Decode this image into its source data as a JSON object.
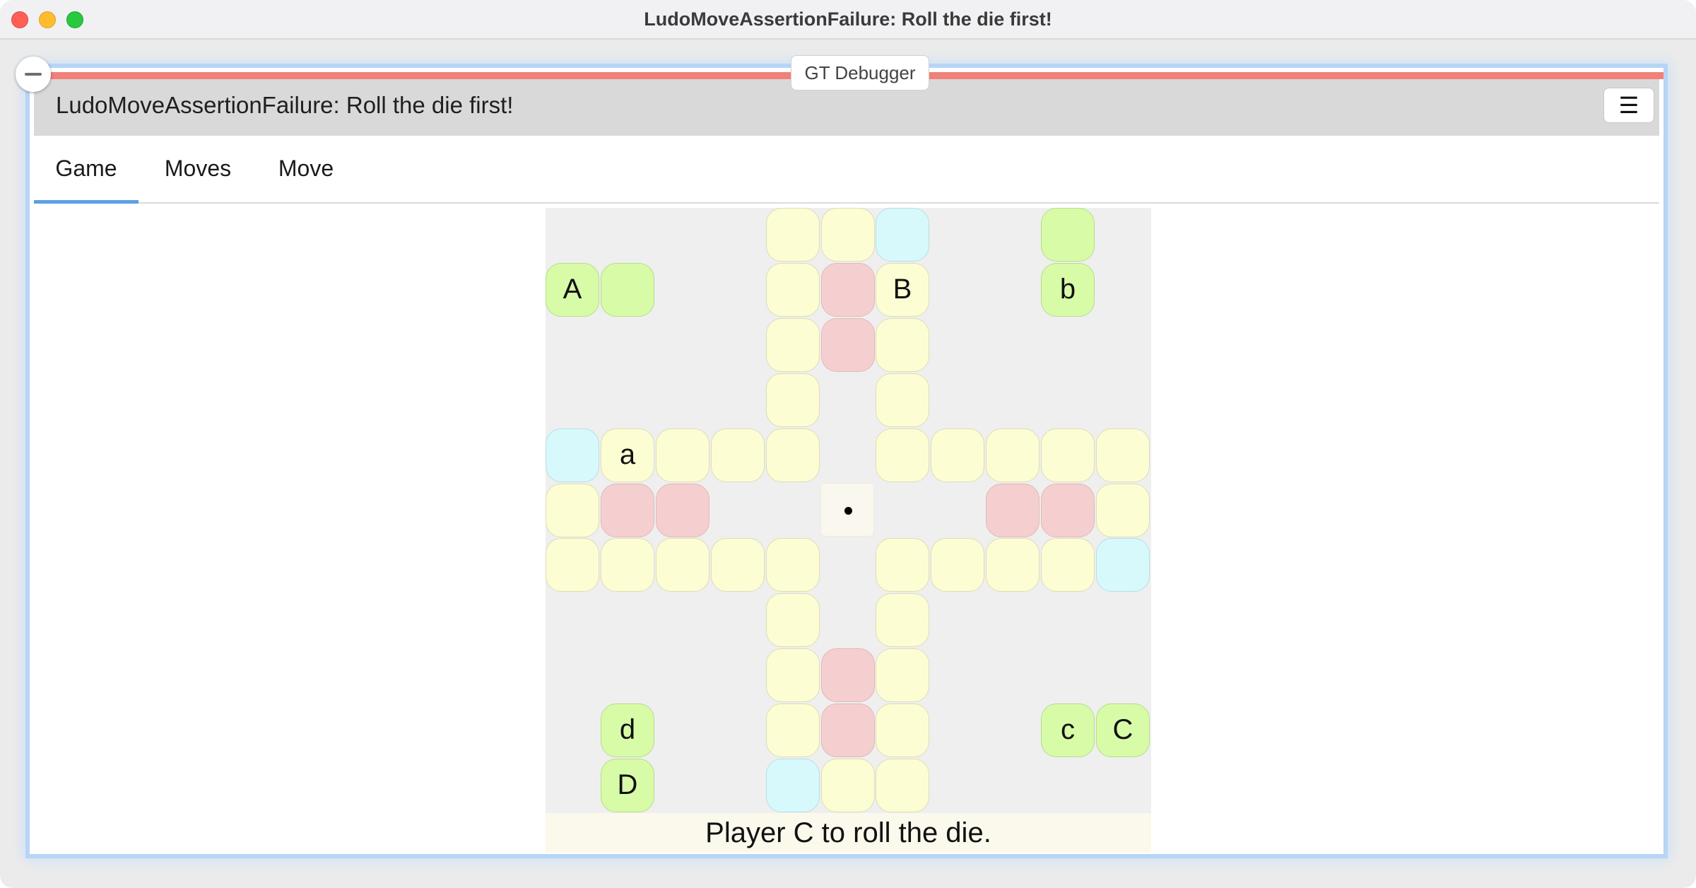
{
  "window": {
    "title": "LudoMoveAssertionFailure: Roll the die first!"
  },
  "debugger_label": "GT Debugger",
  "header": {
    "title": "LudoMoveAssertionFailure: Roll the die first!",
    "menu_icon": "hamburger-menu-icon",
    "menu_glyph": "☰"
  },
  "tabs": [
    {
      "label": "Game",
      "active": true
    },
    {
      "label": "Moves",
      "active": false
    },
    {
      "label": "Move",
      "active": false
    }
  ],
  "colors": {
    "error_bar": "#f08078",
    "tab_underline": "#5aa0e6",
    "track": "#fdfdd3",
    "home_lane": "#f5cfcf",
    "start_square": "#d7f9fb",
    "token_square": "#d8fba8"
  },
  "board": {
    "grid_size": 11,
    "die_value": 1,
    "cells": [
      {
        "r": 0,
        "c": 4,
        "kind": "yellow",
        "label": ""
      },
      {
        "r": 0,
        "c": 5,
        "kind": "yellow",
        "label": ""
      },
      {
        "r": 0,
        "c": 6,
        "kind": "cyan",
        "label": ""
      },
      {
        "r": 0,
        "c": 9,
        "kind": "green",
        "label": ""
      },
      {
        "r": 1,
        "c": 0,
        "kind": "green",
        "label": "A"
      },
      {
        "r": 1,
        "c": 1,
        "kind": "green",
        "label": ""
      },
      {
        "r": 1,
        "c": 4,
        "kind": "yellow",
        "label": ""
      },
      {
        "r": 1,
        "c": 5,
        "kind": "red",
        "label": ""
      },
      {
        "r": 1,
        "c": 6,
        "kind": "yellow",
        "label": "B"
      },
      {
        "r": 1,
        "c": 9,
        "kind": "green",
        "label": "b"
      },
      {
        "r": 2,
        "c": 4,
        "kind": "yellow",
        "label": ""
      },
      {
        "r": 2,
        "c": 5,
        "kind": "red",
        "label": ""
      },
      {
        "r": 2,
        "c": 6,
        "kind": "yellow",
        "label": ""
      },
      {
        "r": 3,
        "c": 4,
        "kind": "yellow",
        "label": ""
      },
      {
        "r": 3,
        "c": 6,
        "kind": "yellow",
        "label": ""
      },
      {
        "r": 4,
        "c": 0,
        "kind": "cyan",
        "label": ""
      },
      {
        "r": 4,
        "c": 1,
        "kind": "yellow",
        "label": "a"
      },
      {
        "r": 4,
        "c": 2,
        "kind": "yellow",
        "label": ""
      },
      {
        "r": 4,
        "c": 3,
        "kind": "yellow",
        "label": ""
      },
      {
        "r": 4,
        "c": 4,
        "kind": "yellow",
        "label": ""
      },
      {
        "r": 4,
        "c": 6,
        "kind": "yellow",
        "label": ""
      },
      {
        "r": 4,
        "c": 7,
        "kind": "yellow",
        "label": ""
      },
      {
        "r": 4,
        "c": 8,
        "kind": "yellow",
        "label": ""
      },
      {
        "r": 4,
        "c": 9,
        "kind": "yellow",
        "label": ""
      },
      {
        "r": 4,
        "c": 10,
        "kind": "yellow",
        "label": ""
      },
      {
        "r": 5,
        "c": 0,
        "kind": "yellow",
        "label": ""
      },
      {
        "r": 5,
        "c": 1,
        "kind": "red",
        "label": ""
      },
      {
        "r": 5,
        "c": 2,
        "kind": "red",
        "label": ""
      },
      {
        "r": 5,
        "c": 8,
        "kind": "red",
        "label": ""
      },
      {
        "r": 5,
        "c": 9,
        "kind": "red",
        "label": ""
      },
      {
        "r": 5,
        "c": 10,
        "kind": "yellow",
        "label": ""
      },
      {
        "r": 6,
        "c": 0,
        "kind": "yellow",
        "label": ""
      },
      {
        "r": 6,
        "c": 1,
        "kind": "yellow",
        "label": ""
      },
      {
        "r": 6,
        "c": 2,
        "kind": "yellow",
        "label": ""
      },
      {
        "r": 6,
        "c": 3,
        "kind": "yellow",
        "label": ""
      },
      {
        "r": 6,
        "c": 4,
        "kind": "yellow",
        "label": ""
      },
      {
        "r": 6,
        "c": 6,
        "kind": "yellow",
        "label": ""
      },
      {
        "r": 6,
        "c": 7,
        "kind": "yellow",
        "label": ""
      },
      {
        "r": 6,
        "c": 8,
        "kind": "yellow",
        "label": ""
      },
      {
        "r": 6,
        "c": 9,
        "kind": "yellow",
        "label": ""
      },
      {
        "r": 6,
        "c": 10,
        "kind": "cyan",
        "label": ""
      },
      {
        "r": 7,
        "c": 4,
        "kind": "yellow",
        "label": ""
      },
      {
        "r": 7,
        "c": 6,
        "kind": "yellow",
        "label": ""
      },
      {
        "r": 8,
        "c": 4,
        "kind": "yellow",
        "label": ""
      },
      {
        "r": 8,
        "c": 5,
        "kind": "red",
        "label": ""
      },
      {
        "r": 8,
        "c": 6,
        "kind": "yellow",
        "label": ""
      },
      {
        "r": 9,
        "c": 1,
        "kind": "green",
        "label": "d"
      },
      {
        "r": 9,
        "c": 4,
        "kind": "yellow",
        "label": ""
      },
      {
        "r": 9,
        "c": 5,
        "kind": "red",
        "label": ""
      },
      {
        "r": 9,
        "c": 6,
        "kind": "yellow",
        "label": ""
      },
      {
        "r": 9,
        "c": 9,
        "kind": "green",
        "label": "c"
      },
      {
        "r": 9,
        "c": 10,
        "kind": "green",
        "label": "C"
      },
      {
        "r": 10,
        "c": 1,
        "kind": "green",
        "label": "D"
      },
      {
        "r": 10,
        "c": 4,
        "kind": "cyan",
        "label": ""
      },
      {
        "r": 10,
        "c": 5,
        "kind": "yellow",
        "label": ""
      },
      {
        "r": 10,
        "c": 6,
        "kind": "yellow",
        "label": ""
      }
    ]
  },
  "status": "Player C to roll the die."
}
